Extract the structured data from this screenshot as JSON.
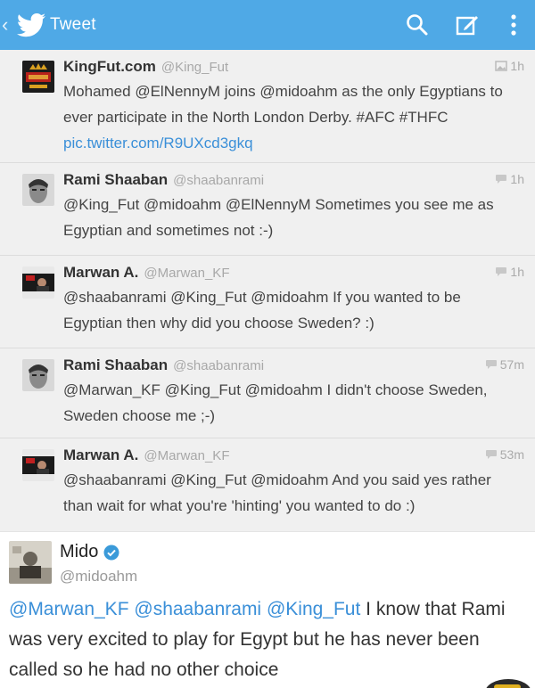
{
  "header": {
    "back_glyph": "‹",
    "title": "Tweet",
    "icons": [
      "twitter-bird-icon",
      "search-icon",
      "compose-icon",
      "overflow-menu-icon"
    ],
    "bar_color": "#4fa9e6"
  },
  "thread": [
    {
      "name": "KingFut.com",
      "handle": "@King_Fut",
      "time": "1h",
      "time_icon": "media-icon",
      "text": "Mohamed @ElNennyM joins @midoahm as the only Egyptians to ever participate in the North London Derby. #AFC #THFC",
      "link": "pic.twitter.com/R9UXcd3gkq"
    },
    {
      "name": "Rami Shaaban",
      "handle": "@shaabanrami",
      "time": "1h",
      "time_icon": "conversation-icon",
      "text": "@King_Fut @midoahm @ElNennyM Sometimes you see me as Egyptian and sometimes not :-)"
    },
    {
      "name": "Marwan A.",
      "handle": "@Marwan_KF",
      "time": "1h",
      "time_icon": "conversation-icon",
      "text": "@shaabanrami @King_Fut @midoahm If you wanted to be Egyptian then why did you choose Sweden? :)"
    },
    {
      "name": "Rami Shaaban",
      "handle": "@shaabanrami",
      "time": "57m",
      "time_icon": "conversation-icon",
      "text": "@Marwan_KF @King_Fut @midoahm I didn't choose Sweden, Sweden choose me ;-)"
    },
    {
      "name": "Marwan A.",
      "handle": "@Marwan_KF",
      "time": "53m",
      "time_icon": "conversation-icon",
      "text": "@shaabanrami @King_Fut @midoahm And you said yes rather than wait for what you're 'hinting' you wanted to do :)"
    }
  ],
  "main_tweet": {
    "name": "Mido",
    "handle": "@midoahm",
    "verified": true,
    "mentions": [
      "@Marwan_KF",
      "@shaabanrami",
      "@King_Fut"
    ],
    "text_rest": " I know that Rami was very excited to play for Egypt but he has never been called so he had no other choice",
    "mention_color": "#3a8fd8"
  }
}
